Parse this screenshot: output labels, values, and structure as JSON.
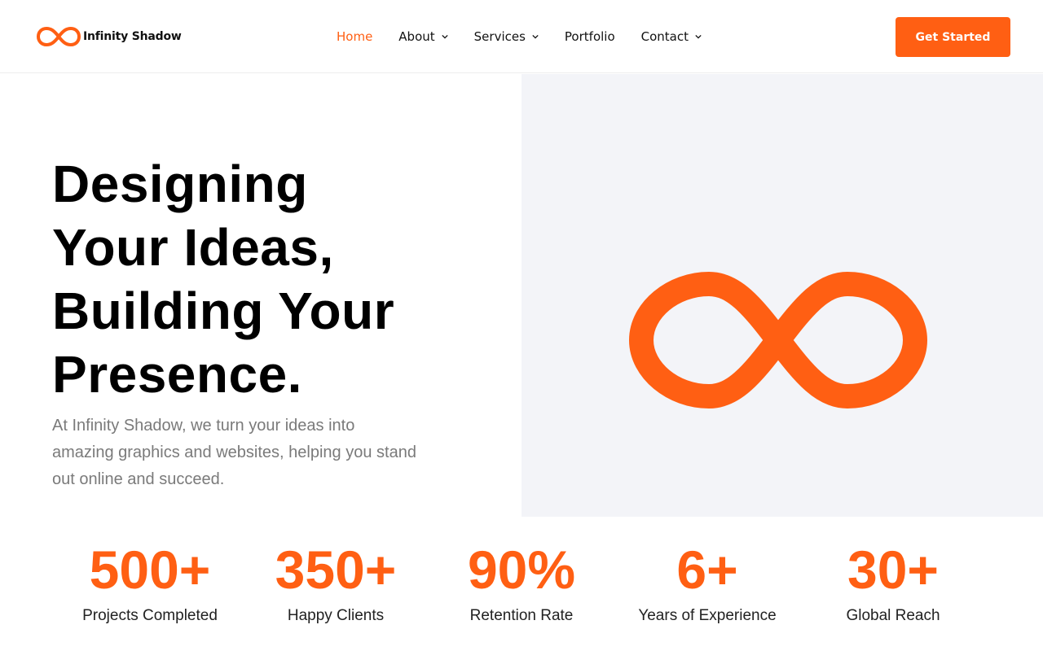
{
  "brand": {
    "name": "Infinity Shadow",
    "logo_icon": "infinity-icon",
    "accent_color": "#ff5f13"
  },
  "nav": {
    "items": [
      {
        "label": "Home",
        "active": true,
        "has_dropdown": false
      },
      {
        "label": "About",
        "active": false,
        "has_dropdown": true
      },
      {
        "label": "Services",
        "active": false,
        "has_dropdown": true
      },
      {
        "label": "Portfolio",
        "active": false,
        "has_dropdown": false
      },
      {
        "label": "Contact",
        "active": false,
        "has_dropdown": true
      }
    ],
    "cta_label": "Get Started"
  },
  "hero": {
    "title_lines": [
      "Designing",
      "Your Ideas,",
      "Building Your",
      "Presence."
    ],
    "subtitle": "At Infinity Shadow, we turn your ideas into amazing graphics and websites, helping you stand out online and succeed.",
    "graphic_icon": "infinity-icon"
  },
  "stats": [
    {
      "value": "500+",
      "label": "Projects Completed"
    },
    {
      "value": "350+",
      "label": "Happy Clients"
    },
    {
      "value": "90%",
      "label": "Retention Rate"
    },
    {
      "value": "6+",
      "label": "Years of Experience"
    },
    {
      "value": "30+",
      "label": "Global Reach"
    }
  ]
}
